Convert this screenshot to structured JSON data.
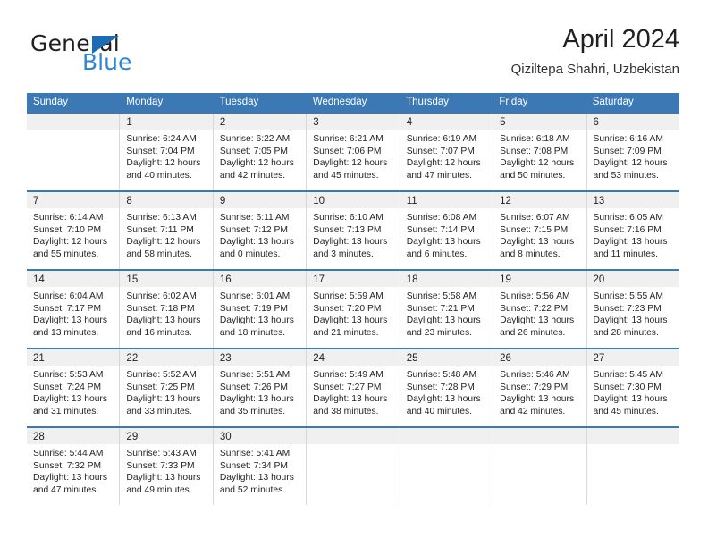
{
  "brand": {
    "name_top": "General",
    "name_bottom": "Blue",
    "triangle_icon": "triangle-icon",
    "accent_color": "#2f86d2",
    "header_color": "#3b78b4"
  },
  "header": {
    "month_title": "April 2024",
    "location": "Qiziltepa Shahri, Uzbekistan"
  },
  "calendar": {
    "day_headers": [
      "Sunday",
      "Monday",
      "Tuesday",
      "Wednesday",
      "Thursday",
      "Friday",
      "Saturday"
    ],
    "weeks": [
      [
        {
          "day": "",
          "sunrise": "",
          "sunset": "",
          "daylight_1": "",
          "daylight_2": ""
        },
        {
          "day": "1",
          "sunrise": "Sunrise: 6:24 AM",
          "sunset": "Sunset: 7:04 PM",
          "daylight_1": "Daylight: 12 hours",
          "daylight_2": "and 40 minutes."
        },
        {
          "day": "2",
          "sunrise": "Sunrise: 6:22 AM",
          "sunset": "Sunset: 7:05 PM",
          "daylight_1": "Daylight: 12 hours",
          "daylight_2": "and 42 minutes."
        },
        {
          "day": "3",
          "sunrise": "Sunrise: 6:21 AM",
          "sunset": "Sunset: 7:06 PM",
          "daylight_1": "Daylight: 12 hours",
          "daylight_2": "and 45 minutes."
        },
        {
          "day": "4",
          "sunrise": "Sunrise: 6:19 AM",
          "sunset": "Sunset: 7:07 PM",
          "daylight_1": "Daylight: 12 hours",
          "daylight_2": "and 47 minutes."
        },
        {
          "day": "5",
          "sunrise": "Sunrise: 6:18 AM",
          "sunset": "Sunset: 7:08 PM",
          "daylight_1": "Daylight: 12 hours",
          "daylight_2": "and 50 minutes."
        },
        {
          "day": "6",
          "sunrise": "Sunrise: 6:16 AM",
          "sunset": "Sunset: 7:09 PM",
          "daylight_1": "Daylight: 12 hours",
          "daylight_2": "and 53 minutes."
        }
      ],
      [
        {
          "day": "7",
          "sunrise": "Sunrise: 6:14 AM",
          "sunset": "Sunset: 7:10 PM",
          "daylight_1": "Daylight: 12 hours",
          "daylight_2": "and 55 minutes."
        },
        {
          "day": "8",
          "sunrise": "Sunrise: 6:13 AM",
          "sunset": "Sunset: 7:11 PM",
          "daylight_1": "Daylight: 12 hours",
          "daylight_2": "and 58 minutes."
        },
        {
          "day": "9",
          "sunrise": "Sunrise: 6:11 AM",
          "sunset": "Sunset: 7:12 PM",
          "daylight_1": "Daylight: 13 hours",
          "daylight_2": "and 0 minutes."
        },
        {
          "day": "10",
          "sunrise": "Sunrise: 6:10 AM",
          "sunset": "Sunset: 7:13 PM",
          "daylight_1": "Daylight: 13 hours",
          "daylight_2": "and 3 minutes."
        },
        {
          "day": "11",
          "sunrise": "Sunrise: 6:08 AM",
          "sunset": "Sunset: 7:14 PM",
          "daylight_1": "Daylight: 13 hours",
          "daylight_2": "and 6 minutes."
        },
        {
          "day": "12",
          "sunrise": "Sunrise: 6:07 AM",
          "sunset": "Sunset: 7:15 PM",
          "daylight_1": "Daylight: 13 hours",
          "daylight_2": "and 8 minutes."
        },
        {
          "day": "13",
          "sunrise": "Sunrise: 6:05 AM",
          "sunset": "Sunset: 7:16 PM",
          "daylight_1": "Daylight: 13 hours",
          "daylight_2": "and 11 minutes."
        }
      ],
      [
        {
          "day": "14",
          "sunrise": "Sunrise: 6:04 AM",
          "sunset": "Sunset: 7:17 PM",
          "daylight_1": "Daylight: 13 hours",
          "daylight_2": "and 13 minutes."
        },
        {
          "day": "15",
          "sunrise": "Sunrise: 6:02 AM",
          "sunset": "Sunset: 7:18 PM",
          "daylight_1": "Daylight: 13 hours",
          "daylight_2": "and 16 minutes."
        },
        {
          "day": "16",
          "sunrise": "Sunrise: 6:01 AM",
          "sunset": "Sunset: 7:19 PM",
          "daylight_1": "Daylight: 13 hours",
          "daylight_2": "and 18 minutes."
        },
        {
          "day": "17",
          "sunrise": "Sunrise: 5:59 AM",
          "sunset": "Sunset: 7:20 PM",
          "daylight_1": "Daylight: 13 hours",
          "daylight_2": "and 21 minutes."
        },
        {
          "day": "18",
          "sunrise": "Sunrise: 5:58 AM",
          "sunset": "Sunset: 7:21 PM",
          "daylight_1": "Daylight: 13 hours",
          "daylight_2": "and 23 minutes."
        },
        {
          "day": "19",
          "sunrise": "Sunrise: 5:56 AM",
          "sunset": "Sunset: 7:22 PM",
          "daylight_1": "Daylight: 13 hours",
          "daylight_2": "and 26 minutes."
        },
        {
          "day": "20",
          "sunrise": "Sunrise: 5:55 AM",
          "sunset": "Sunset: 7:23 PM",
          "daylight_1": "Daylight: 13 hours",
          "daylight_2": "and 28 minutes."
        }
      ],
      [
        {
          "day": "21",
          "sunrise": "Sunrise: 5:53 AM",
          "sunset": "Sunset: 7:24 PM",
          "daylight_1": "Daylight: 13 hours",
          "daylight_2": "and 31 minutes."
        },
        {
          "day": "22",
          "sunrise": "Sunrise: 5:52 AM",
          "sunset": "Sunset: 7:25 PM",
          "daylight_1": "Daylight: 13 hours",
          "daylight_2": "and 33 minutes."
        },
        {
          "day": "23",
          "sunrise": "Sunrise: 5:51 AM",
          "sunset": "Sunset: 7:26 PM",
          "daylight_1": "Daylight: 13 hours",
          "daylight_2": "and 35 minutes."
        },
        {
          "day": "24",
          "sunrise": "Sunrise: 5:49 AM",
          "sunset": "Sunset: 7:27 PM",
          "daylight_1": "Daylight: 13 hours",
          "daylight_2": "and 38 minutes."
        },
        {
          "day": "25",
          "sunrise": "Sunrise: 5:48 AM",
          "sunset": "Sunset: 7:28 PM",
          "daylight_1": "Daylight: 13 hours",
          "daylight_2": "and 40 minutes."
        },
        {
          "day": "26",
          "sunrise": "Sunrise: 5:46 AM",
          "sunset": "Sunset: 7:29 PM",
          "daylight_1": "Daylight: 13 hours",
          "daylight_2": "and 42 minutes."
        },
        {
          "day": "27",
          "sunrise": "Sunrise: 5:45 AM",
          "sunset": "Sunset: 7:30 PM",
          "daylight_1": "Daylight: 13 hours",
          "daylight_2": "and 45 minutes."
        }
      ],
      [
        {
          "day": "28",
          "sunrise": "Sunrise: 5:44 AM",
          "sunset": "Sunset: 7:32 PM",
          "daylight_1": "Daylight: 13 hours",
          "daylight_2": "and 47 minutes."
        },
        {
          "day": "29",
          "sunrise": "Sunrise: 5:43 AM",
          "sunset": "Sunset: 7:33 PM",
          "daylight_1": "Daylight: 13 hours",
          "daylight_2": "and 49 minutes."
        },
        {
          "day": "30",
          "sunrise": "Sunrise: 5:41 AM",
          "sunset": "Sunset: 7:34 PM",
          "daylight_1": "Daylight: 13 hours",
          "daylight_2": "and 52 minutes."
        },
        {
          "day": "",
          "sunrise": "",
          "sunset": "",
          "daylight_1": "",
          "daylight_2": ""
        },
        {
          "day": "",
          "sunrise": "",
          "sunset": "",
          "daylight_1": "",
          "daylight_2": ""
        },
        {
          "day": "",
          "sunrise": "",
          "sunset": "",
          "daylight_1": "",
          "daylight_2": ""
        },
        {
          "day": "",
          "sunrise": "",
          "sunset": "",
          "daylight_1": "",
          "daylight_2": ""
        }
      ]
    ]
  }
}
